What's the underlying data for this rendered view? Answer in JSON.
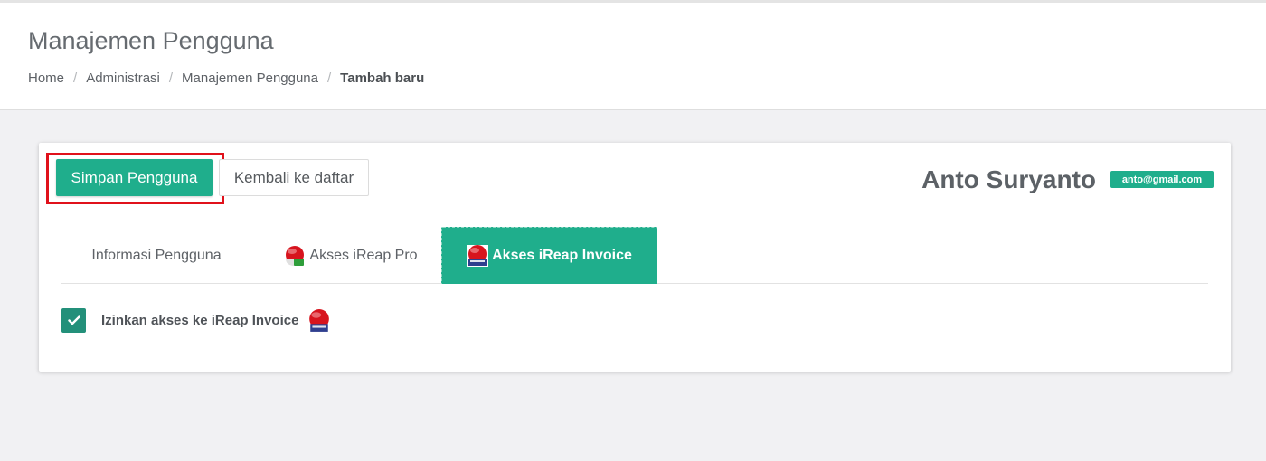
{
  "header": {
    "title": "Manajemen Pengguna",
    "breadcrumb": {
      "home": "Home",
      "admin": "Administrasi",
      "users": "Manajemen Pengguna",
      "current": "Tambah baru",
      "separator": "/"
    }
  },
  "toolbar": {
    "save_label": "Simpan Pengguna",
    "back_label": "Kembali ke daftar"
  },
  "user": {
    "name": "Anto Suryanto",
    "email": "anto@gmail.com"
  },
  "tabs": [
    {
      "label": "Informasi Pengguna",
      "icon": null,
      "active": false
    },
    {
      "label": "Akses iReap Pro",
      "icon": "ireap-pro-icon",
      "active": false
    },
    {
      "label": "Akses iReap Invoice",
      "icon": "ireap-invoice-icon",
      "active": true
    }
  ],
  "permission": {
    "label": "Izinkan akses ke iReap Invoice",
    "checked": true,
    "icon": "ireap-invoice-icon"
  },
  "colors": {
    "accent": "#1fae8c",
    "checkbox": "#23907a",
    "highlight": "#e0111b"
  }
}
